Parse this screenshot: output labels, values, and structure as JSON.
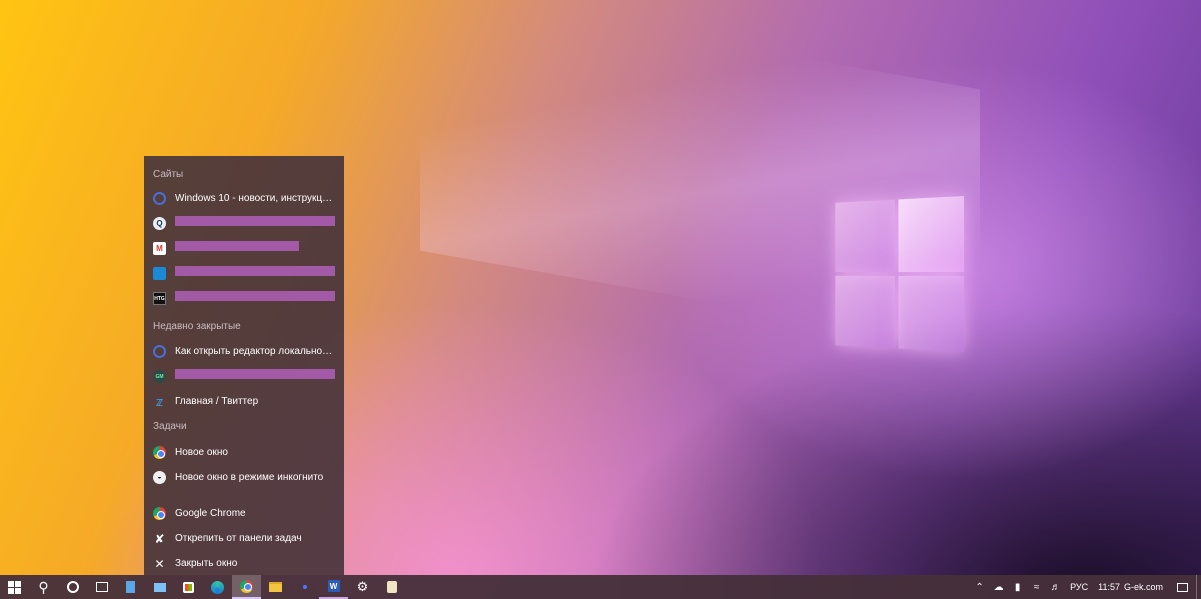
{
  "jumplist": {
    "sites_title": "Сайты",
    "sites": [
      {
        "icon": "globe-icon",
        "label": "Windows 10 - новости, инструкции, о...",
        "redacted": false
      },
      {
        "icon": "search-site-icon",
        "label": "",
        "redacted": true,
        "redact_width": 164
      },
      {
        "icon": "gmail-icon",
        "label": "",
        "redacted": true,
        "redact_width": 124
      },
      {
        "icon": "stack-icon",
        "label": "",
        "redacted": true,
        "redact_width": 164
      },
      {
        "icon": "htg-icon",
        "label": "",
        "redacted": true,
        "redact_width": 164
      }
    ],
    "recent_title": "Недавно закрытые",
    "recent": [
      {
        "icon": "globe-icon",
        "label": "Как открыть редактор локальной гру...",
        "redacted": false
      },
      {
        "icon": "gm-icon",
        "label": "",
        "redacted": true,
        "redact_width": 164
      },
      {
        "icon": "twitter-icon",
        "label": "Главная / Твиттер",
        "redacted": false
      }
    ],
    "tasks_title": "Задачи",
    "tasks": [
      {
        "icon": "chrome-icon",
        "label": "Новое окно"
      },
      {
        "icon": "incognito-icon",
        "label": "Новое окно в режиме инкогнито"
      }
    ],
    "actions": [
      {
        "icon": "chrome-icon",
        "label": "Google Chrome"
      },
      {
        "icon": "unpin-icon",
        "label": "Открепить от панели задач"
      },
      {
        "icon": "close-icon",
        "label": "Закрыть окно"
      }
    ]
  },
  "taskbar": {
    "apps": [
      {
        "name": "start-button",
        "icon": "windows-logo-icon"
      },
      {
        "name": "search-button",
        "icon": "search-icon"
      },
      {
        "name": "cortana-button",
        "icon": "cortana-icon"
      },
      {
        "name": "task-view-button",
        "icon": "task-view-icon"
      },
      {
        "name": "notes-app",
        "icon": "document-icon"
      },
      {
        "name": "mail-app",
        "icon": "mail-icon"
      },
      {
        "name": "store-app",
        "icon": "store-icon"
      },
      {
        "name": "edge-app",
        "icon": "edge-icon"
      },
      {
        "name": "chrome-app",
        "icon": "chrome-icon",
        "state": "active"
      },
      {
        "name": "explorer-app",
        "icon": "folder-icon"
      },
      {
        "name": "small-app",
        "icon": "dot-icon"
      },
      {
        "name": "word-app",
        "icon": "word-icon",
        "state": "running"
      },
      {
        "name": "settings-app",
        "icon": "gear-icon"
      },
      {
        "name": "notepad-app",
        "icon": "scroll-icon"
      }
    ],
    "tray": {
      "language": "РУС",
      "time": "11:57",
      "site": "G-ek.com"
    }
  }
}
